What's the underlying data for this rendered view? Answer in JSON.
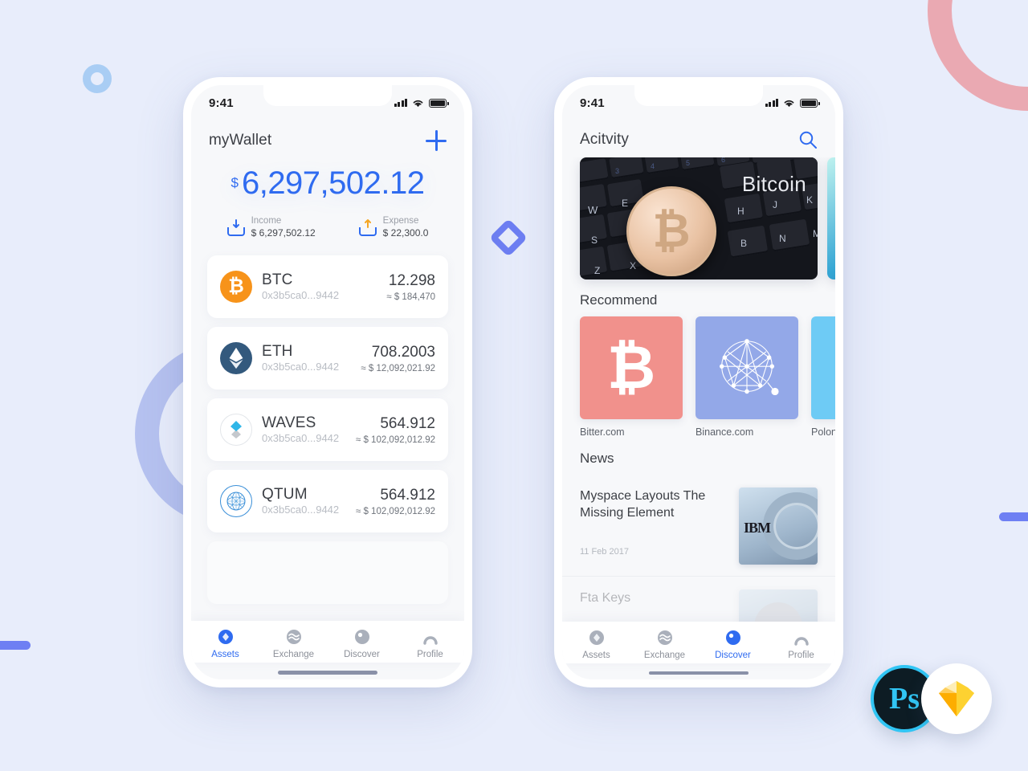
{
  "background": {
    "color": "#e8edfb",
    "decor": [
      {
        "name": "ring-pink",
        "color": "#eaa9b2"
      },
      {
        "name": "ring-small-blue",
        "color": "#a9cdf4"
      },
      {
        "name": "ring-big-periwinkle",
        "color": "#b6c2f0"
      },
      {
        "name": "bar-left",
        "color": "#6e7ff3"
      },
      {
        "name": "bar-right",
        "color": "#6e7ff3"
      },
      {
        "name": "diamond-middle",
        "color": "#6e7ff3"
      }
    ]
  },
  "badges": {
    "photoshop_label": "Ps",
    "sketch_label": "Sketch"
  },
  "wallet_screen": {
    "status_bar": {
      "time": "9:41"
    },
    "header": {
      "title": "myWallet",
      "add_label": "+"
    },
    "balance": {
      "currency_symbol": "$",
      "amount": "6,297,502.12",
      "income": {
        "label": "Income",
        "value": "$ 6,297,502.12"
      },
      "expense": {
        "label": "Expense",
        "value": "$ 22,300.0"
      }
    },
    "assets": [
      {
        "symbol": "BTC",
        "icon": "bitcoin-icon",
        "address": "0x3b5ca0...9442",
        "amount": "12.298",
        "fiat": "≈ $ 184,470"
      },
      {
        "symbol": "ETH",
        "icon": "ethereum-icon",
        "address": "0x3b5ca0...9442",
        "amount": "708.2003",
        "fiat": "≈ $ 12,092,021.92"
      },
      {
        "symbol": "WAVES",
        "icon": "waves-icon",
        "address": "0x3b5ca0...9442",
        "amount": "564.912",
        "fiat": "≈ $ 102,092,012.92"
      },
      {
        "symbol": "QTUM",
        "icon": "qtum-icon",
        "address": "0x3b5ca0...9442",
        "amount": "564.912",
        "fiat": "≈ $ 102,092,012.92"
      }
    ],
    "tabs": [
      {
        "label": "Assets",
        "icon": "assets-icon",
        "active": true
      },
      {
        "label": "Exchange",
        "icon": "exchange-icon",
        "active": false
      },
      {
        "label": "Discover",
        "icon": "discover-icon",
        "active": false
      },
      {
        "label": "Profile",
        "icon": "profile-icon",
        "active": false
      }
    ]
  },
  "discover_screen": {
    "status_bar": {
      "time": "9:41"
    },
    "header": {
      "title": "Acitvity",
      "search_icon": "search-icon"
    },
    "banners": [
      {
        "caption": "Bitcoin",
        "image": "bitcoin-coin-on-keyboard"
      },
      {
        "caption": "",
        "image": "teal-abstract"
      }
    ],
    "recommend": {
      "title": "Recommend",
      "items": [
        {
          "label": "Bitter.com",
          "color": "#f1918c",
          "icon": "bitcoin-glyph"
        },
        {
          "label": "Binance.com",
          "color": "#93a8e8",
          "icon": "network-globe-icon"
        },
        {
          "label": "Polonie",
          "color": "#6ecbf5",
          "icon": "plus-glyph"
        }
      ]
    },
    "news": {
      "title": "News",
      "items": [
        {
          "title": "Myspace Layouts The Missing Element",
          "date": "11 Feb 2017",
          "thumb": "ibm-server-photo"
        },
        {
          "title": "Fta Keys",
          "date": "",
          "thumb": "portrait-photo"
        }
      ]
    },
    "tabs": [
      {
        "label": "Assets",
        "icon": "assets-icon",
        "active": false
      },
      {
        "label": "Exchange",
        "icon": "exchange-icon",
        "active": false
      },
      {
        "label": "Discover",
        "icon": "discover-icon",
        "active": true
      },
      {
        "label": "Profile",
        "icon": "profile-icon",
        "active": false
      }
    ]
  }
}
